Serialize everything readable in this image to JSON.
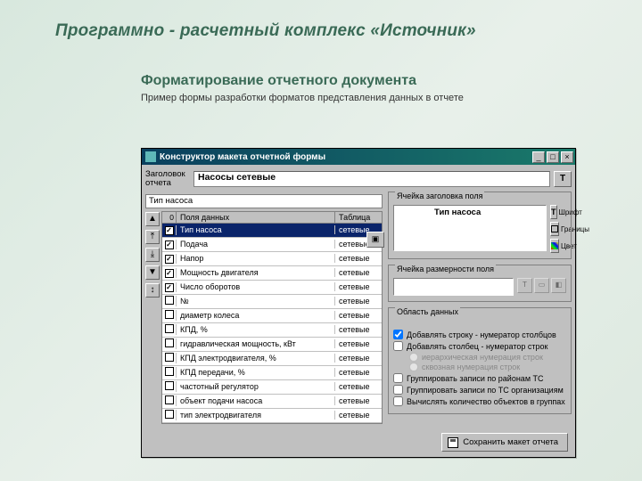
{
  "slide": {
    "title": "Программно - расчетный комплекс «Источник»",
    "section": "Форматирование отчетного документа",
    "subtitle": "Пример формы разработки форматов представления данных в отчете"
  },
  "window": {
    "title": "Конструктор макета отчетной формы",
    "min": "_",
    "max": "□",
    "close": "×"
  },
  "header": {
    "label": "Заголовок отчета",
    "value": "Насосы сетевые",
    "t": "T"
  },
  "currentField": "Тип насоса",
  "gridHeaders": {
    "num": "0",
    "field": "Поля данных",
    "table": "Таблица"
  },
  "sideButtons": [
    "▲",
    "⤒",
    "⤓",
    "▼",
    "↕"
  ],
  "rows": [
    {
      "chk": true,
      "name": "Тип насоса",
      "table": "сетевые",
      "sel": true
    },
    {
      "chk": true,
      "name": "Подача",
      "table": "сетевые"
    },
    {
      "chk": true,
      "name": "Напор",
      "table": "сетевые"
    },
    {
      "chk": true,
      "name": "Мощность двигателя",
      "table": "сетевые"
    },
    {
      "chk": true,
      "name": "Число оборотов",
      "table": "сетевые"
    },
    {
      "chk": false,
      "name": "№",
      "table": "сетевые"
    },
    {
      "chk": false,
      "name": "диаметр колеса",
      "table": "сетевые"
    },
    {
      "chk": false,
      "name": "КПД, %",
      "table": "сетевые"
    },
    {
      "chk": false,
      "name": "гидравлическая мощность, кВт",
      "table": "сетевые"
    },
    {
      "chk": false,
      "name": "КПД электродвигателя, %",
      "table": "сетевые"
    },
    {
      "chk": false,
      "name": "КПД передачи, %",
      "table": "сетевые"
    },
    {
      "chk": false,
      "name": "частотный регулятор",
      "table": "сетевые"
    },
    {
      "chk": false,
      "name": "объект подачи насоса",
      "table": "сетевые"
    },
    {
      "chk": false,
      "name": "тип электродвигателя",
      "table": "сетевые"
    }
  ],
  "cellHeader": {
    "group": "Ячейка заголовка поля",
    "preview": "Тип насоса",
    "font": "Шрифт",
    "borders": "Границы",
    "color": "Цвет"
  },
  "cellDim": {
    "group": "Ячейка размерности поля"
  },
  "dataArea": {
    "group": "Область данных",
    "addRow": "Добавлять строку - нумератор столбцов",
    "addCol": "Добавлять столбец - нумератор строк",
    "radHier": "иерархическая нумерация строк",
    "radSeq": "сквозная нумерация строк",
    "groupTs": "Группировать записи по районам ТС",
    "groupOrg": "Группировать записи по ТС организациям",
    "calc": "Вычислять количество объектов в группах"
  },
  "save": "Сохранить макет отчета",
  "paneToggle": "▣"
}
